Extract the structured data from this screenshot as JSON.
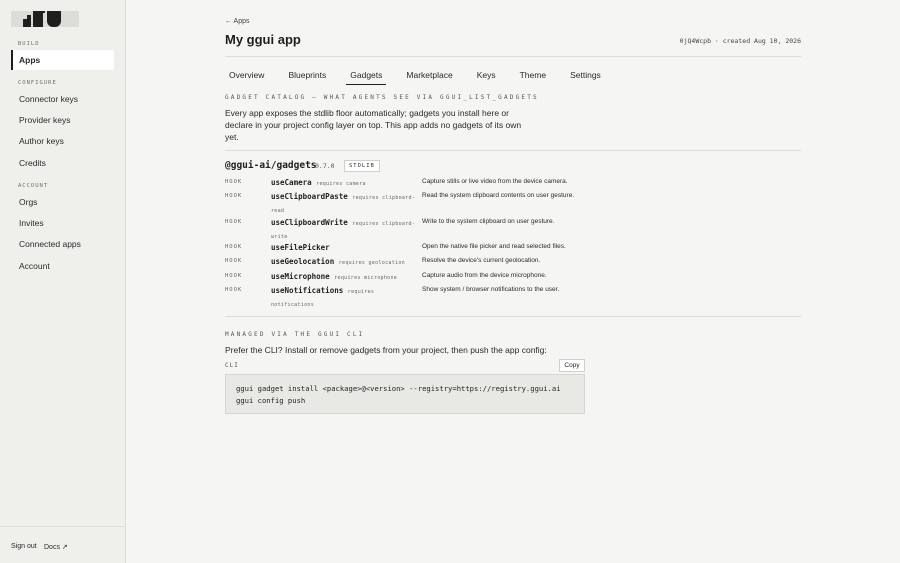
{
  "sidebar": {
    "sections": {
      "build": "BUILD",
      "configure": "CONFIGURE",
      "account": "ACCOUNT"
    },
    "items": {
      "apps": "Apps",
      "connector_keys": "Connector keys",
      "provider_keys": "Provider keys",
      "author_keys": "Author keys",
      "credits": "Credits",
      "orgs": "Orgs",
      "invites": "Invites",
      "connected_apps": "Connected apps",
      "account": "Account"
    },
    "footer": {
      "sign_out": "Sign out",
      "docs": "Docs ↗"
    }
  },
  "header": {
    "back": "← Apps",
    "title": "My ggui app",
    "meta": "0jQ4Wcpb · created Aug 10, 2026"
  },
  "tabs": [
    "Overview",
    "Blueprints",
    "Gadgets",
    "Marketplace",
    "Keys",
    "Theme",
    "Settings"
  ],
  "active_tab": "Gadgets",
  "catalog": {
    "caption": "GADGET CATALOG — WHAT AGENTS SEE VIA GGUI_LIST_GADGETS",
    "intro_line1": "Every app exposes the stdlib floor automatically; gadgets you install here or",
    "intro_line2": "declare in your project config layer on top. This app adds no gadgets of its own",
    "intro_line3": "yet."
  },
  "package": {
    "name": "@ggui-ai/gadgets",
    "version": "0.7.0",
    "badge": "STDLIB"
  },
  "gadgets": [
    {
      "kind": "HOOK",
      "name": "useCamera",
      "req1": "requires camera",
      "req2": "",
      "desc": "Capture stills or live video from the device camera."
    },
    {
      "kind": "HOOK",
      "name": "useClipboardPaste",
      "req1": "requires clipboard-",
      "req2": "read",
      "desc": "Read the system clipboard contents on user gesture."
    },
    {
      "kind": "HOOK",
      "name": "useClipboardWrite",
      "req1": "requires clipboard-",
      "req2": "write",
      "desc": "Write to the system clipboard on user gesture."
    },
    {
      "kind": "HOOK",
      "name": "useFilePicker",
      "req1": "",
      "req2": "",
      "desc": "Open the native file picker and read selected files."
    },
    {
      "kind": "HOOK",
      "name": "useGeolocation",
      "req1": "requires geolocation",
      "req2": "",
      "desc": "Resolve the device's current geolocation."
    },
    {
      "kind": "HOOK",
      "name": "useMicrophone",
      "req1": "requires microphone",
      "req2": "",
      "desc": "Capture audio from the device microphone."
    },
    {
      "kind": "HOOK",
      "name": "useNotifications",
      "req1": "requires",
      "req2": "notifications",
      "desc": "Show system / browser notifications to the user."
    }
  ],
  "cli": {
    "caption": "MANAGED VIA THE GGUI CLI",
    "intro": "Prefer the CLI? Install or remove gadgets from your project, then push the app config:",
    "label": "CLI",
    "copy": "Copy",
    "line1": "ggui gadget install <package>@<version> --registry=https://registry.ggui.ai",
    "line2": "ggui config push"
  }
}
